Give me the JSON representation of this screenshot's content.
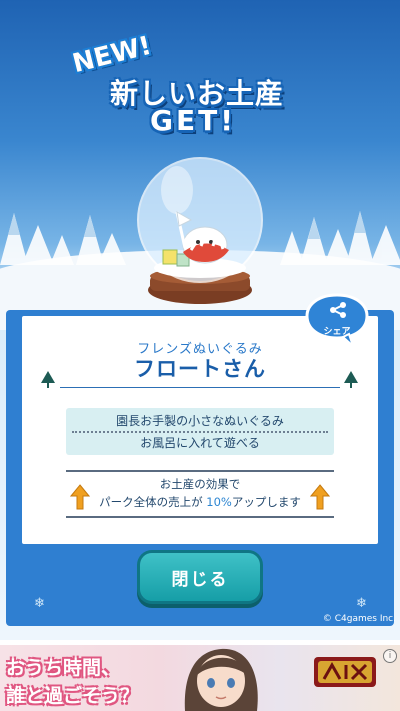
{
  "header": {
    "new_tag": "NEW!",
    "title_line1": "新しいお土産",
    "title_line2": "GET!"
  },
  "item": {
    "category": "フレンズぬいぐるみ",
    "name": "フロートさん",
    "description_line1": "園長お手製の小さなぬいぐるみ",
    "description_line2": "お風呂に入れて遊べる"
  },
  "effect": {
    "line1": "お土産の効果で",
    "line2_prefix": "パーク全体の売上が ",
    "line2_percent": "10%",
    "line2_suffix": "アップします"
  },
  "share": {
    "label": "シェア"
  },
  "buttons": {
    "close_label": "閉じる"
  },
  "footer": {
    "copyright": "© C4games Inc."
  },
  "ad": {
    "line1": "おうち時間、",
    "line2": "誰と過ごそう？",
    "info": "i"
  },
  "colors": {
    "panel_blue": "#2f7fd1",
    "title_text": "#1a5ea9",
    "button_teal": "#169ea7",
    "arrow_orange": "#f0a020",
    "description_bg": "#d8eff2"
  }
}
